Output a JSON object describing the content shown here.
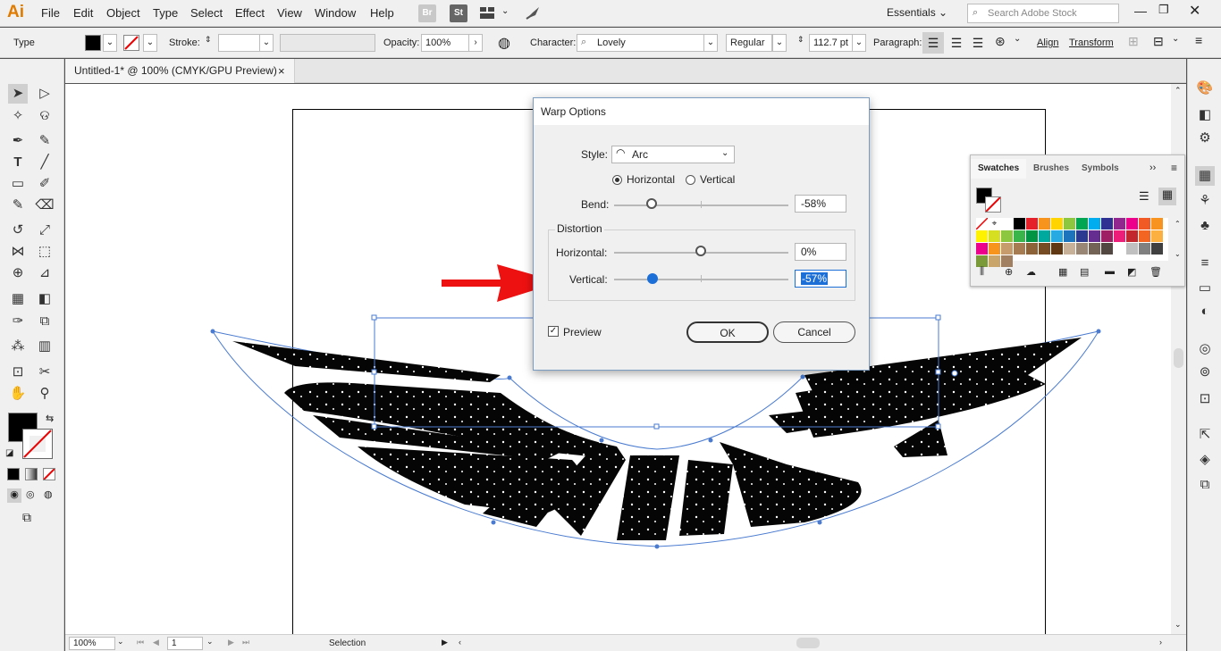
{
  "app": {
    "logo": "Ai"
  },
  "menu": [
    "File",
    "Edit",
    "Object",
    "Type",
    "Select",
    "Effect",
    "View",
    "Window",
    "Help"
  ],
  "menubar_buttons": {
    "bridge": "Br",
    "stock": "St"
  },
  "workspace": {
    "label": "Essentials",
    "search_placeholder": "Search Adobe Stock"
  },
  "control": {
    "tool_label": "Type",
    "stroke_label": "Stroke:",
    "opacity_label": "Opacity:",
    "opacity_value": "100%",
    "character_label": "Character:",
    "font_name": "Lovely",
    "font_style": "Regular",
    "font_size": "112.7 pt",
    "paragraph_label": "Paragraph:",
    "align_label": "Align",
    "transform_label": "Transform"
  },
  "document": {
    "tab_title": "Untitled-1* @ 100% (CMYK/GPU Preview)",
    "close": "×"
  },
  "status": {
    "zoom": "100%",
    "page": "1",
    "tool": "Selection"
  },
  "swatches": {
    "tabs": [
      "Swatches",
      "Brushes",
      "Symbols"
    ]
  },
  "dialog": {
    "title": "Warp Options",
    "style_label": "Style:",
    "style_value": "Arc",
    "horizontal_label": "Horizontal",
    "vertical_label": "Vertical",
    "orientation": "Horizontal",
    "bend_label": "Bend:",
    "bend_value": "-58%",
    "distortion_label": "Distortion",
    "dist_h_label": "Horizontal:",
    "dist_h_value": "0%",
    "dist_v_label": "Vertical:",
    "dist_v_value": "-57%",
    "preview_label": "Preview",
    "preview_checked": true,
    "ok_label": "OK",
    "cancel_label": "Cancel"
  },
  "colors": {
    "accent": "#1d6fd8",
    "arrow": "#ee1111",
    "selection": "#4a7bd0"
  }
}
